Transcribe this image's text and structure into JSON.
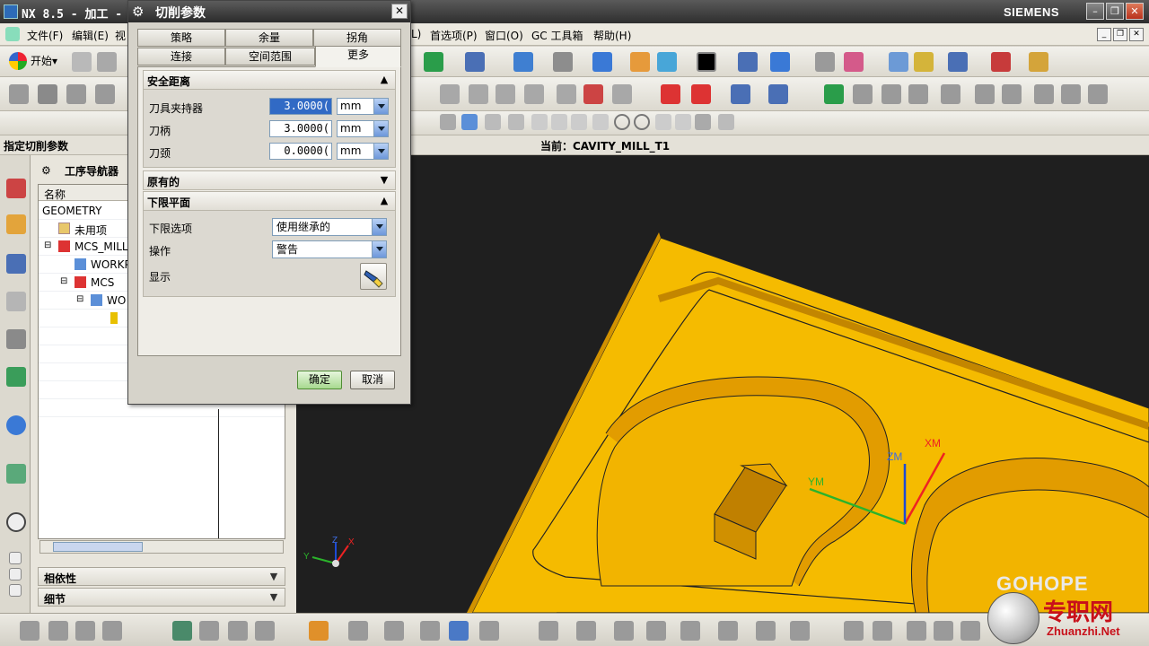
{
  "titlebar": {
    "app": "NX 8.5 - 加工 -",
    "brand": "SIEMENS"
  },
  "menubar": {
    "file": "文件(F)",
    "edit": "编辑(E)",
    "view": "视",
    "partial_before_prefs": "L)",
    "preferences": "首选项(P)",
    "window": "窗口(O)",
    "gc_toolbox": "GC 工具箱",
    "help": "帮助(H)"
  },
  "start_button": "开始▾",
  "cue_prompt": "指定切削参数",
  "current_operation": "当前：CAVITY_MILL_T1",
  "navigator": {
    "title": "工序导航器",
    "column_name": "名称",
    "rows": [
      "GEOMETRY",
      "未用项",
      "MCS_MILL",
      "WORKP",
      "MCS",
      "WO"
    ],
    "panel_dependencies": "相依性",
    "panel_details": "细节"
  },
  "dialog": {
    "title": "切削参数",
    "tabs": {
      "strategy": "策略",
      "stock": "余量",
      "corners": "拐角",
      "connections": "连接",
      "containment": "空间范围",
      "more": "更多"
    },
    "safe_clearance": {
      "header": "安全距离",
      "tool_holder_label": "刀具夹持器",
      "tool_holder_value": "3.0000(",
      "tool_holder_unit": "mm",
      "shank_label": "刀柄",
      "shank_value": "3.0000(",
      "shank_unit": "mm",
      "neck_label": "刀颈",
      "neck_value": "0.0000(",
      "neck_unit": "mm"
    },
    "original_header": "原有的",
    "lower_limit": {
      "header": "下限平面",
      "option_label": "下限选项",
      "option_value": "使用继承的",
      "action_label": "操作",
      "action_value": "警告",
      "display_label": "显示"
    },
    "ok": "确定",
    "cancel": "取消"
  },
  "viewport": {
    "triad_labels": {
      "xm": "XM",
      "ym": "YM",
      "zm": "ZM"
    },
    "mini_triad": {
      "x": "X",
      "y": "Y",
      "z": "Z"
    }
  },
  "watermark": {
    "brand": "GOHOPE",
    "cn": "专职网",
    "site": "Zhuanzhi.Net"
  },
  "colors": {
    "part_yellow": "#f5bb00",
    "accent_blue": "#316ac5",
    "ok_green": "#a7d98f"
  }
}
